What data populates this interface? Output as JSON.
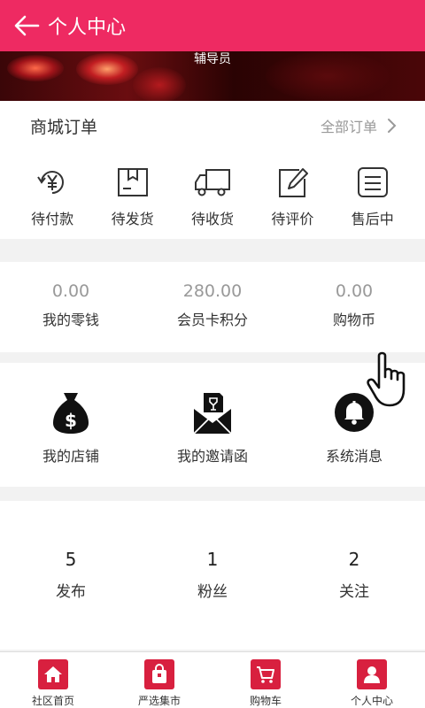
{
  "header": {
    "title": "个人中心"
  },
  "banner": {
    "role": "辅导员"
  },
  "orders": {
    "title": "商城订单",
    "all_label": "全部订单",
    "items": [
      {
        "label": "待付款",
        "icon": "yen-coin-icon"
      },
      {
        "label": "待发货",
        "icon": "package-icon"
      },
      {
        "label": "待收货",
        "icon": "truck-icon"
      },
      {
        "label": "待评价",
        "icon": "edit-icon"
      },
      {
        "label": "售后中",
        "icon": "list-icon"
      }
    ]
  },
  "wallet": [
    {
      "value": "0.00",
      "label": "我的零钱"
    },
    {
      "value": "280.00",
      "label": "会员卡积分"
    },
    {
      "value": "0.00",
      "label": "购物币"
    }
  ],
  "tools": [
    {
      "label": "我的店铺",
      "icon": "money-bag-icon"
    },
    {
      "label": "我的邀请函",
      "icon": "invitation-icon"
    },
    {
      "label": "系统消息",
      "icon": "bell-icon"
    }
  ],
  "social": [
    {
      "value": "5",
      "label": "发布"
    },
    {
      "value": "1",
      "label": "粉丝"
    },
    {
      "value": "2",
      "label": "关注"
    }
  ],
  "tabbar": [
    {
      "label": "社区首页",
      "icon": "home-icon"
    },
    {
      "label": "严选集市",
      "icon": "shopping-bag-icon"
    },
    {
      "label": "购物车",
      "icon": "cart-icon"
    },
    {
      "label": "个人中心",
      "icon": "user-icon",
      "active": true
    }
  ],
  "colors": {
    "accent": "#ee2a62",
    "tab_icon": "#d8203f"
  }
}
